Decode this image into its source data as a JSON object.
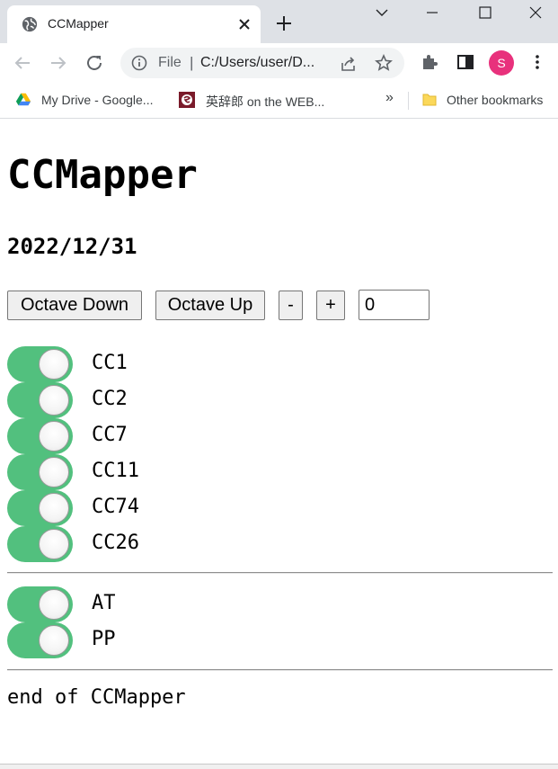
{
  "browser": {
    "tab": {
      "title": "CCMapper",
      "favicon": "globe-icon"
    },
    "omnibox": {
      "scheme_label": "File",
      "separator": "|",
      "url": "C:/Users/user/D..."
    },
    "profile_initial": "S",
    "bookmarks": [
      {
        "label": "My Drive - Google...",
        "icon": "google-drive-icon"
      },
      {
        "label": "英辞郎 on the WEB...",
        "icon": "eijiro-icon"
      }
    ],
    "bookmarks_overflow": "»",
    "other_bookmarks": "Other bookmarks"
  },
  "page": {
    "title": "CCMapper",
    "date": "2022/12/31",
    "controls": {
      "octave_down": "Octave Down",
      "octave_up": "Octave Up",
      "minus": "-",
      "plus": "+",
      "value": "0"
    },
    "cc_toggles": [
      {
        "label": "CC1",
        "on": true
      },
      {
        "label": "CC2",
        "on": true
      },
      {
        "label": "CC7",
        "on": true
      },
      {
        "label": "CC11",
        "on": true
      },
      {
        "label": "CC74",
        "on": true
      },
      {
        "label": "CC26",
        "on": true
      }
    ],
    "other_toggles": [
      {
        "label": "AT",
        "on": true
      },
      {
        "label": "PP",
        "on": true
      }
    ],
    "footer": "end of CCMapper",
    "colors": {
      "toggle_on": "#52c07e"
    }
  }
}
